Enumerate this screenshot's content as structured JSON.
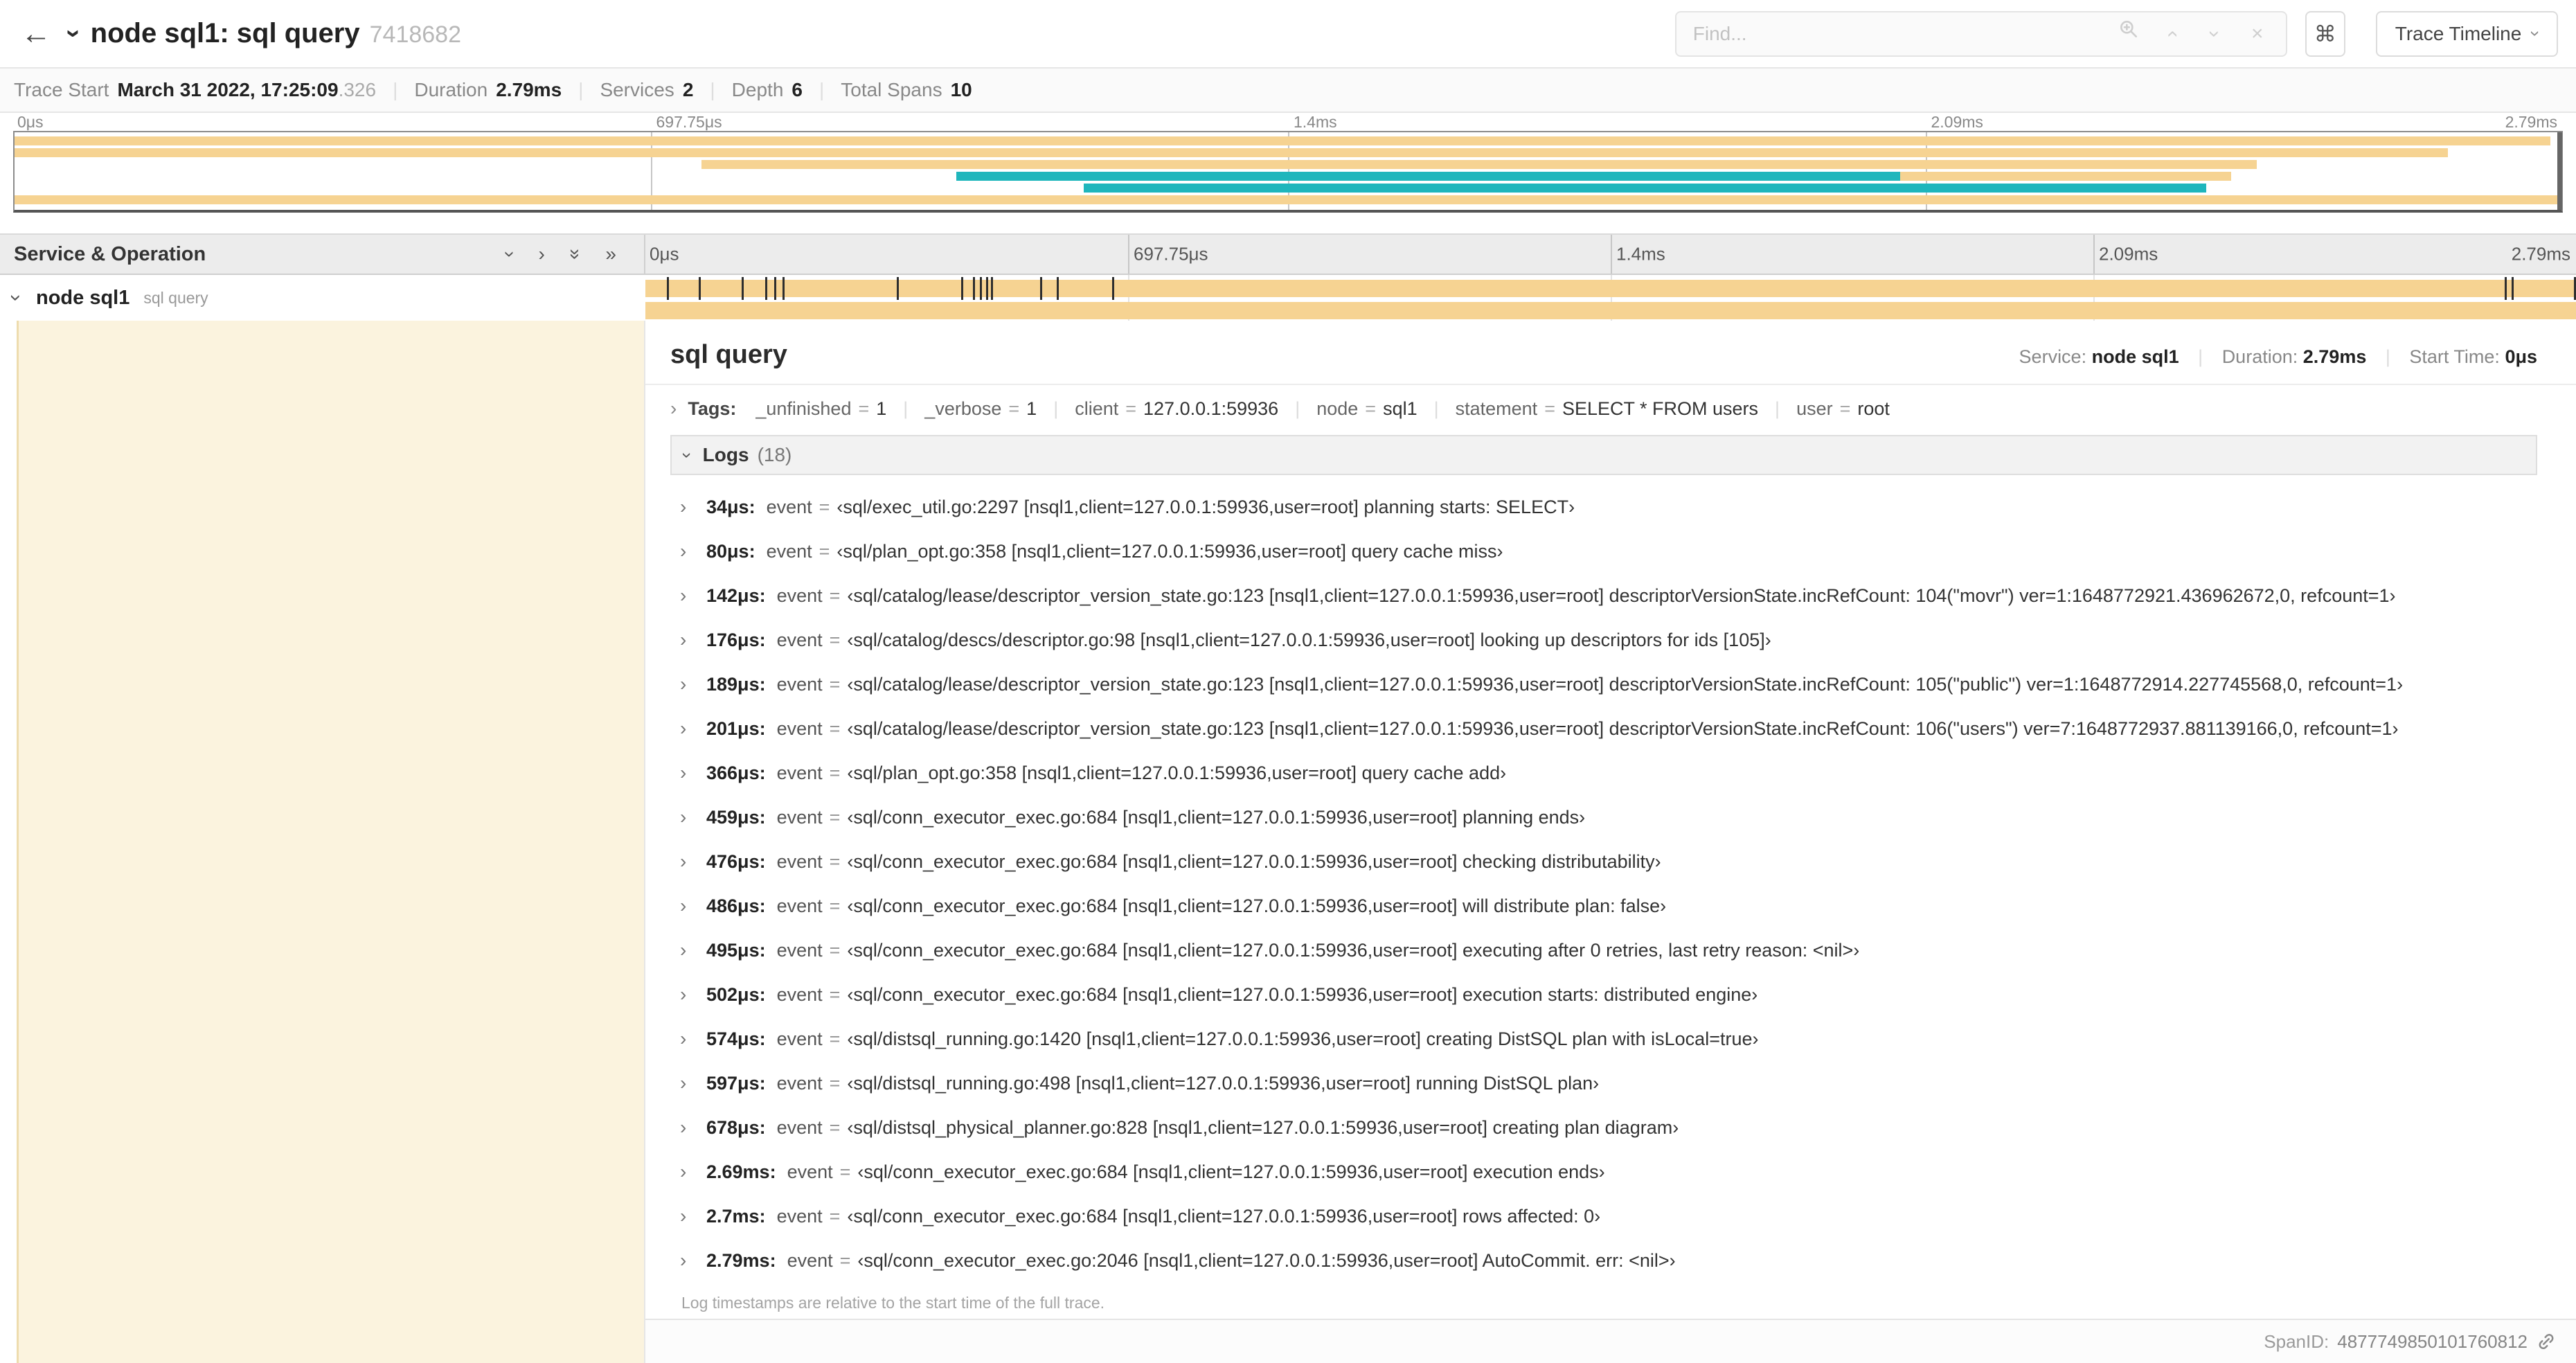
{
  "ui": {
    "sep": "|"
  },
  "icons": {
    "back_arrow": "←",
    "chevron_right": "›",
    "chevron_double_right": "»",
    "close": "×",
    "command": "⌘"
  },
  "header": {
    "title": "node sql1: sql query",
    "trace_id": "7418682",
    "find_placeholder": "Find...",
    "view_button_label": "Trace Timeline"
  },
  "summary": {
    "items": [
      {
        "label": "Trace Start",
        "value": "March 31 2022, 17:25:09",
        "dim": ".326"
      },
      {
        "label": "Duration",
        "value": "2.79ms"
      },
      {
        "label": "Services",
        "value": "2"
      },
      {
        "label": "Depth",
        "value": "6"
      },
      {
        "label": "Total Spans",
        "value": "10"
      }
    ]
  },
  "timeline": {
    "left_header": "Service & Operation",
    "ticks": [
      {
        "label": "0μs",
        "pct": 0
      },
      {
        "label": "697.75μs",
        "pct": 25
      },
      {
        "label": "1.4ms",
        "pct": 50
      },
      {
        "label": "2.09ms",
        "pct": 75
      },
      {
        "label": "2.79ms",
        "pct": 100
      }
    ],
    "row": {
      "service": "node sql1",
      "operation": "sql query"
    }
  },
  "minimap": {
    "spans": [
      {
        "row": 0,
        "start": 0,
        "end": 99.5,
        "color": "tan"
      },
      {
        "row": 1,
        "start": 0,
        "end": 25,
        "color": "tan"
      },
      {
        "row": 1,
        "start": 25,
        "end": 95.5,
        "color": "tan"
      },
      {
        "row": 2,
        "start": 27,
        "end": 88,
        "color": "tan"
      },
      {
        "row": 3,
        "start": 37,
        "end": 87,
        "color": "tan"
      },
      {
        "row": 3,
        "start": 37,
        "end": 74,
        "color": "teal"
      },
      {
        "row": 4,
        "start": 42,
        "end": 86,
        "color": "teal"
      },
      {
        "row": 5,
        "start": 0,
        "end": 100,
        "color": "tan"
      }
    ]
  },
  "detail": {
    "title": "sql query",
    "meta": {
      "service_label": "Service:",
      "service_value": "node sql1",
      "duration_label": "Duration:",
      "duration_value": "2.79ms",
      "start_label": "Start Time:",
      "start_value": "0μs"
    },
    "tags_label": "Tags:",
    "tags": [
      {
        "key": "_unfinished",
        "value": "1"
      },
      {
        "key": "_verbose",
        "value": "1"
      },
      {
        "key": "client",
        "value": "127.0.0.1:59936"
      },
      {
        "key": "node",
        "value": "sql1"
      },
      {
        "key": "statement",
        "value": "SELECT * FROM users"
      },
      {
        "key": "user",
        "value": "root"
      }
    ],
    "logs_label": "Logs",
    "logs_count": "(18)",
    "log_field": "event",
    "logs": [
      {
        "time": "34μs:",
        "value": "‹sql/exec_util.go:2297 [nsql1,client=127.0.0.1:59936,user=root] planning starts: SELECT›"
      },
      {
        "time": "80μs:",
        "value": "‹sql/plan_opt.go:358 [nsql1,client=127.0.0.1:59936,user=root] query cache miss›"
      },
      {
        "time": "142μs:",
        "value": "‹sql/catalog/lease/descriptor_version_state.go:123 [nsql1,client=127.0.0.1:59936,user=root] descriptorVersionState.incRefCount: 104(\"movr\") ver=1:1648772921.436962672,0, refcount=1›"
      },
      {
        "time": "176μs:",
        "value": "‹sql/catalog/descs/descriptor.go:98 [nsql1,client=127.0.0.1:59936,user=root] looking up descriptors for ids [105]›"
      },
      {
        "time": "189μs:",
        "value": "‹sql/catalog/lease/descriptor_version_state.go:123 [nsql1,client=127.0.0.1:59936,user=root] descriptorVersionState.incRefCount: 105(\"public\") ver=1:1648772914.227745568,0, refcount=1›"
      },
      {
        "time": "201μs:",
        "value": "‹sql/catalog/lease/descriptor_version_state.go:123 [nsql1,client=127.0.0.1:59936,user=root] descriptorVersionState.incRefCount: 106(\"users\") ver=7:1648772937.881139166,0, refcount=1›"
      },
      {
        "time": "366μs:",
        "value": "‹sql/plan_opt.go:358 [nsql1,client=127.0.0.1:59936,user=root] query cache add›"
      },
      {
        "time": "459μs:",
        "value": "‹sql/conn_executor_exec.go:684 [nsql1,client=127.0.0.1:59936,user=root] planning ends›"
      },
      {
        "time": "476μs:",
        "value": "‹sql/conn_executor_exec.go:684 [nsql1,client=127.0.0.1:59936,user=root] checking distributability›"
      },
      {
        "time": "486μs:",
        "value": "‹sql/conn_executor_exec.go:684 [nsql1,client=127.0.0.1:59936,user=root] will distribute plan: false›"
      },
      {
        "time": "495μs:",
        "value": "‹sql/conn_executor_exec.go:684 [nsql1,client=127.0.0.1:59936,user=root] executing after 0 retries, last retry reason: <nil>›"
      },
      {
        "time": "502μs:",
        "value": "‹sql/conn_executor_exec.go:684 [nsql1,client=127.0.0.1:59936,user=root] execution starts: distributed engine›"
      },
      {
        "time": "574μs:",
        "value": "‹sql/distsql_running.go:1420 [nsql1,client=127.0.0.1:59936,user=root] creating DistSQL plan with isLocal=true›"
      },
      {
        "time": "597μs:",
        "value": "‹sql/distsql_running.go:498 [nsql1,client=127.0.0.1:59936,user=root] running DistSQL plan›"
      },
      {
        "time": "678μs:",
        "value": "‹sql/distsql_physical_planner.go:828 [nsql1,client=127.0.0.1:59936,user=root] creating plan diagram›"
      },
      {
        "time": "2.69ms:",
        "value": "‹sql/conn_executor_exec.go:684 [nsql1,client=127.0.0.1:59936,user=root] execution ends›"
      },
      {
        "time": "2.7ms:",
        "value": "‹sql/conn_executor_exec.go:684 [nsql1,client=127.0.0.1:59936,user=root] rows affected: 0›"
      },
      {
        "time": "2.79ms:",
        "value": "‹sql/conn_executor_exec.go:2046 [nsql1,client=127.0.0.1:59936,user=root] AutoCommit. err: <nil>›"
      }
    ],
    "logs_note": "Log timestamps are relative to the start time of the full trace.",
    "footer": {
      "span_id_label": "SpanID:",
      "span_id": "4877749850101760812"
    }
  }
}
